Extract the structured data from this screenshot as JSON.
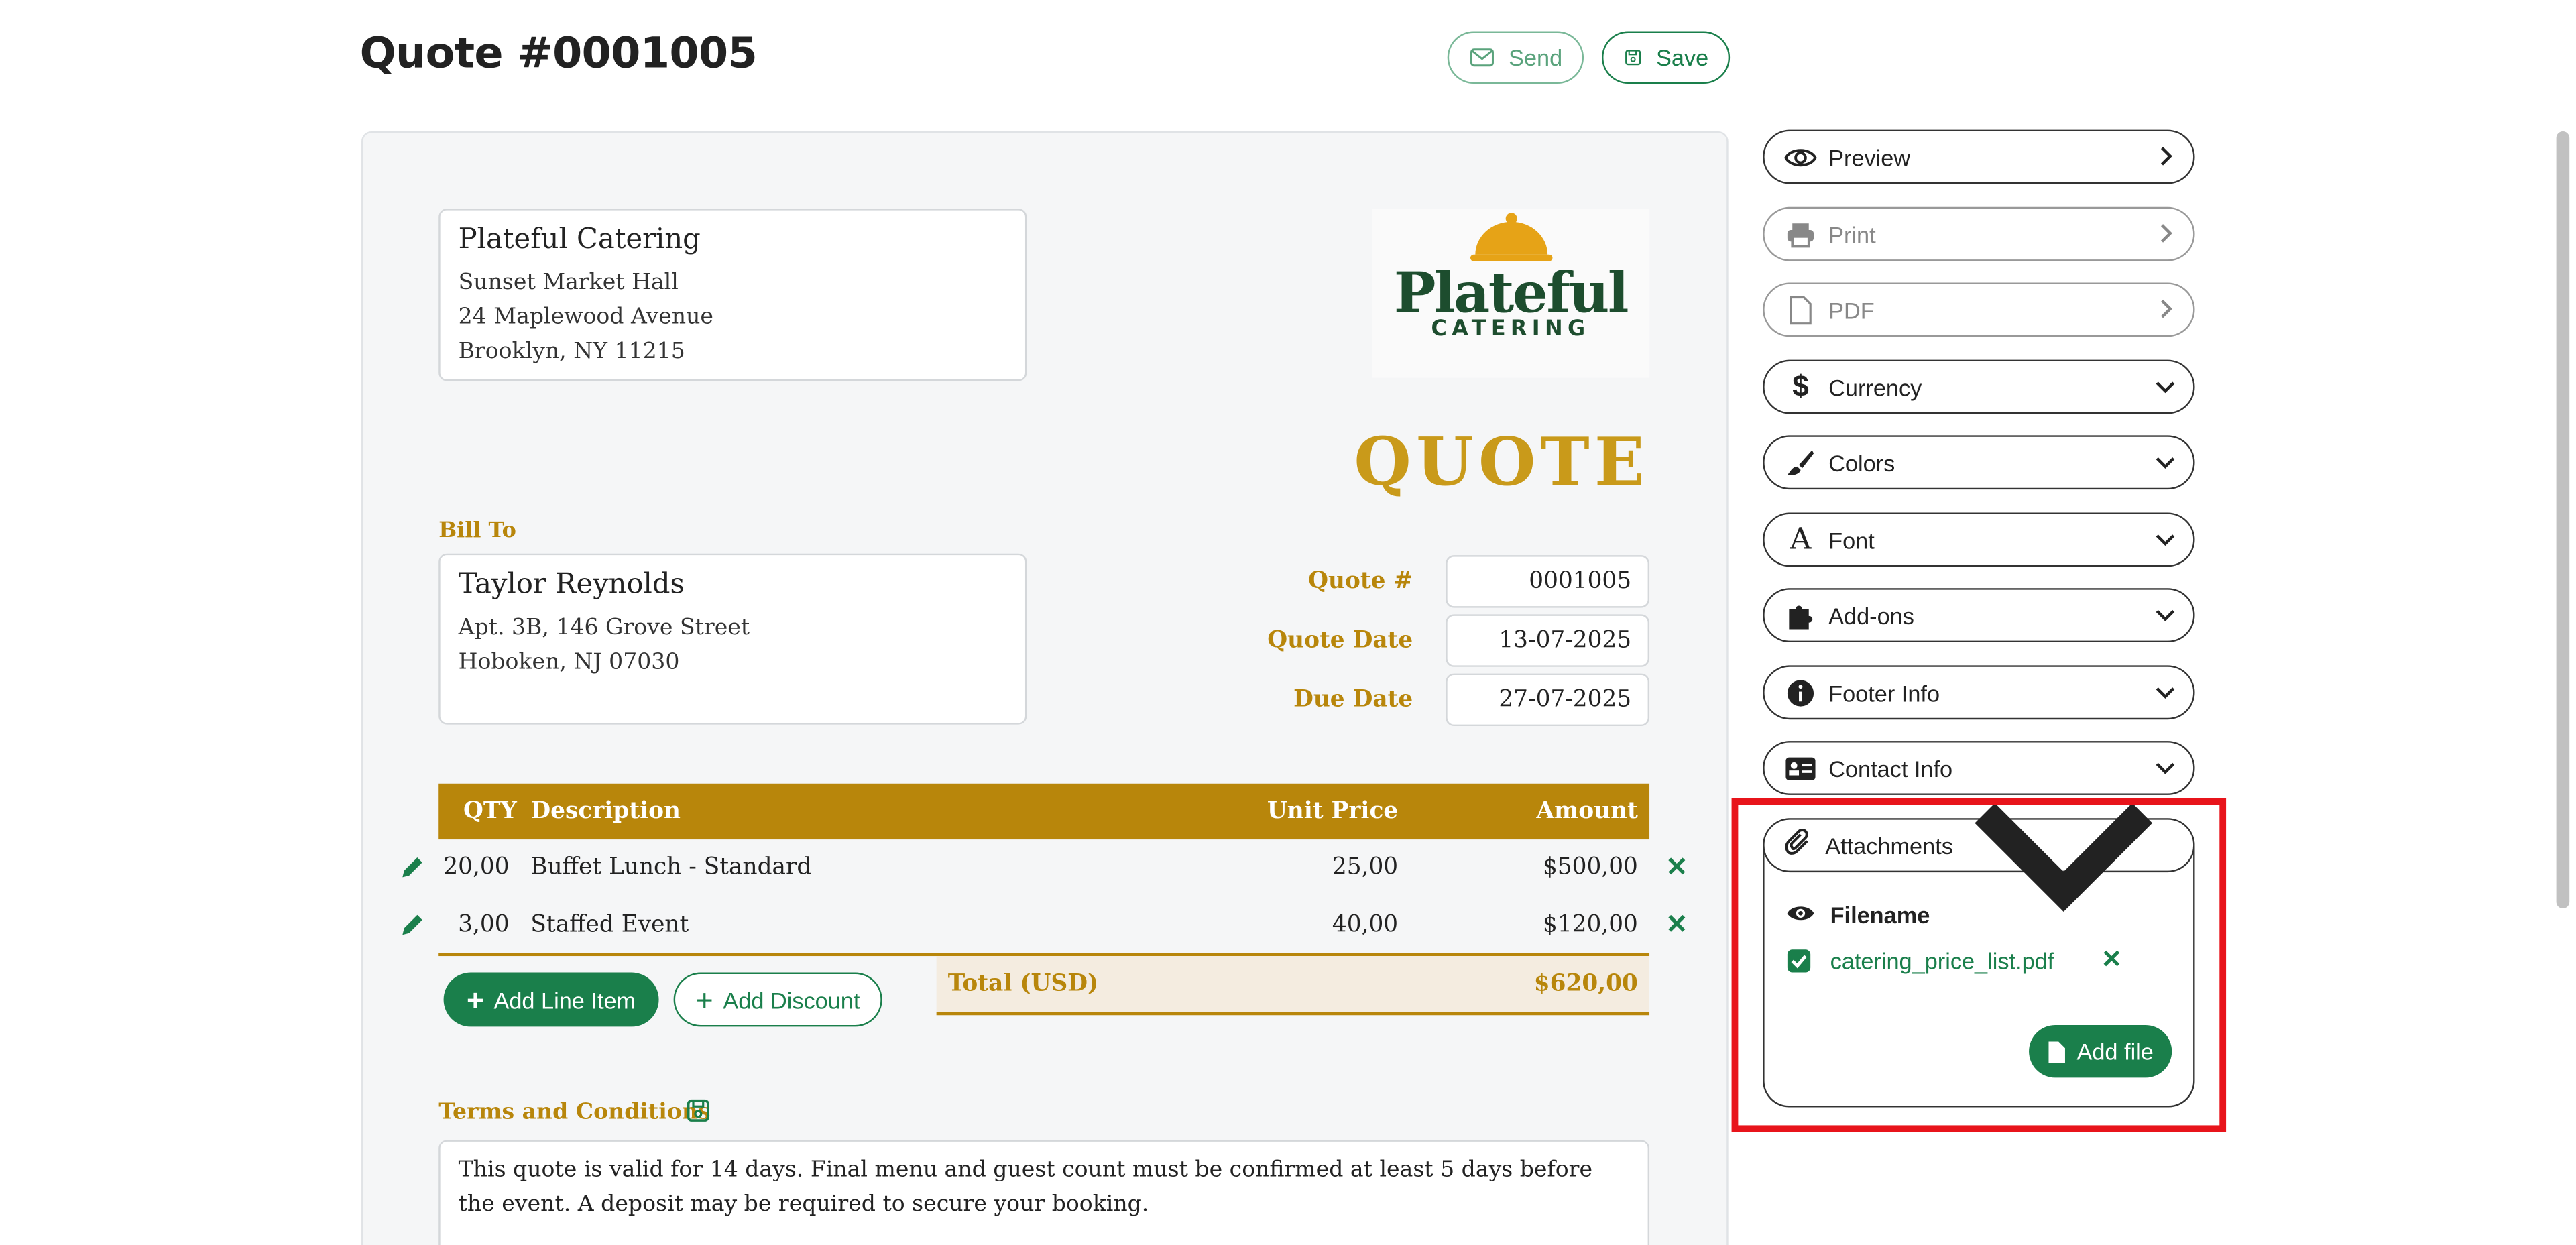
{
  "header": {
    "title": "Quote #0001005",
    "send_label": "Send",
    "save_label": "Save"
  },
  "from": {
    "name": "Plateful Catering",
    "lines": [
      "Sunset Market Hall",
      "24 Maplewood Avenue",
      "Brooklyn, NY 11215"
    ]
  },
  "logo": {
    "word": "Plateful",
    "sub": "CATERING"
  },
  "doc_type": "QUOTE",
  "bill_to": {
    "label": "Bill To",
    "name": "Taylor Reynolds",
    "lines": [
      "Apt. 3B, 146 Grove Street",
      "Hoboken, NJ 07030"
    ]
  },
  "meta": {
    "quote_no_label": "Quote #",
    "quote_no": "0001005",
    "quote_date_label": "Quote Date",
    "quote_date": "13-07-2025",
    "due_date_label": "Due Date",
    "due_date": "27-07-2025"
  },
  "table": {
    "headers": {
      "qty": "QTY",
      "desc": "Description",
      "unit": "Unit Price",
      "amount": "Amount"
    },
    "rows": [
      {
        "qty": "20,00",
        "desc": "Buffet Lunch - Standard",
        "unit": "25,00",
        "amount": "$500,00"
      },
      {
        "qty": "3,00",
        "desc": "Staffed Event",
        "unit": "40,00",
        "amount": "$120,00"
      }
    ],
    "total_label": "Total (USD)",
    "total_value": "$620,00"
  },
  "actions": {
    "add_line": "Add Line Item",
    "add_discount": "Add Discount"
  },
  "terms": {
    "label": "Terms and Conditions",
    "text": "This quote is valid for 14 days. Final menu and guest count must be confirmed at least 5 days before the event. A deposit may be required to secure your booking."
  },
  "sidebar": {
    "items": [
      {
        "label": "Preview",
        "icon": "eye-icon"
      },
      {
        "label": "Print",
        "icon": "printer-icon"
      },
      {
        "label": "PDF",
        "icon": "pdf-icon"
      },
      {
        "label": "Currency",
        "icon": "dollar-icon"
      },
      {
        "label": "Colors",
        "icon": "paintbrush-icon"
      },
      {
        "label": "Font",
        "icon": "font-icon"
      },
      {
        "label": "Add-ons",
        "icon": "puzzle-icon"
      },
      {
        "label": "Footer Info",
        "icon": "info-icon"
      },
      {
        "label": "Contact Info",
        "icon": "contact-card-icon"
      }
    ],
    "attachments": {
      "label": "Attachments",
      "column": "Filename",
      "file": "catering_price_list.pdf",
      "add_file": "Add file"
    }
  },
  "colors": {
    "accent": "#b8860b",
    "green": "#1a7f4b",
    "highlight": "#e8141b"
  }
}
